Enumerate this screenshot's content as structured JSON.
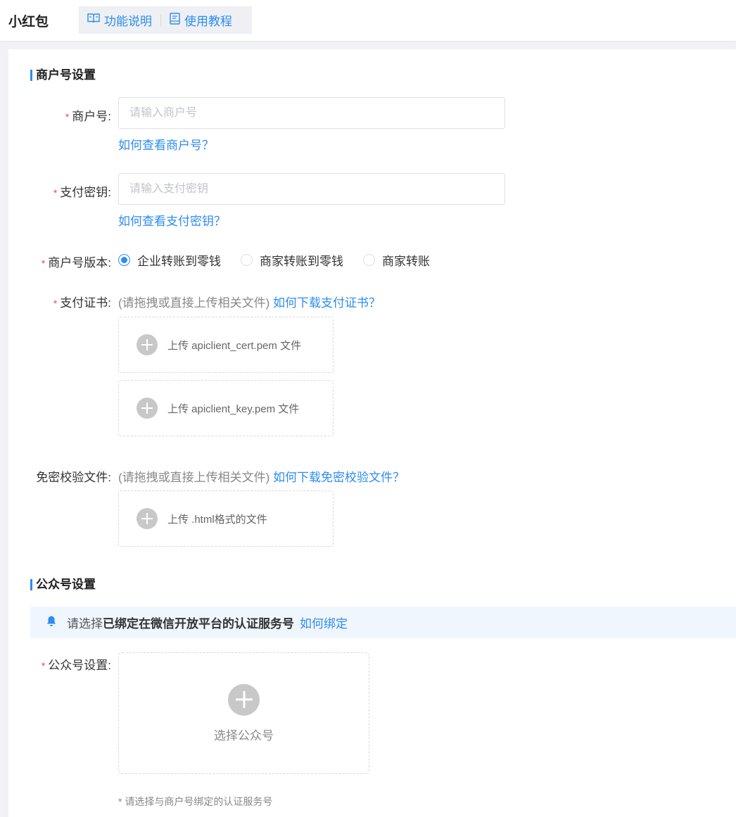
{
  "header": {
    "title": "小红包",
    "tabs": [
      {
        "label": "功能说明",
        "icon": "book-open-icon"
      },
      {
        "label": "使用教程",
        "icon": "document-icon"
      }
    ]
  },
  "merchant_section": {
    "title": "商户号设置",
    "merchant_id": {
      "label": "商户号:",
      "placeholder": "请输入商户号",
      "value": "",
      "help_link": "如何查看商户号？"
    },
    "pay_key": {
      "label": "支付密钥:",
      "placeholder": "请输入支付密钥",
      "value": "",
      "help_link": "如何查看支付密钥？"
    },
    "version": {
      "label": "商户号版本:",
      "options": [
        "企业转账到零钱",
        "商家转账到零钱",
        "商家转账"
      ],
      "selected": "企业转账到零钱"
    },
    "certificate": {
      "label": "支付证书:",
      "hint": "(请拖拽或直接上传相关文件)",
      "help_link": "如何下载支付证书？",
      "uploads": [
        "上传 apiclient_cert.pem 文件",
        "上传 apiclient_key.pem 文件"
      ]
    },
    "verify_file": {
      "label": "免密校验文件:",
      "hint": "(请拖拽或直接上传相关文件)",
      "help_link": "如何下载免密校验文件？",
      "upload": "上传 .html格式的文件"
    }
  },
  "official_section": {
    "title": "公众号设置",
    "notice": {
      "prefix": "请选择",
      "bold": "已绑定在微信开放平台的认证服务号",
      "link": "如何绑定"
    },
    "account": {
      "label": "公众号设置:",
      "upload": "选择公众号",
      "footnote": "* 请选择与商户号绑定的认证服务号"
    }
  },
  "colors": {
    "accent": "#2d8cf0",
    "required": "#e94b4b"
  }
}
